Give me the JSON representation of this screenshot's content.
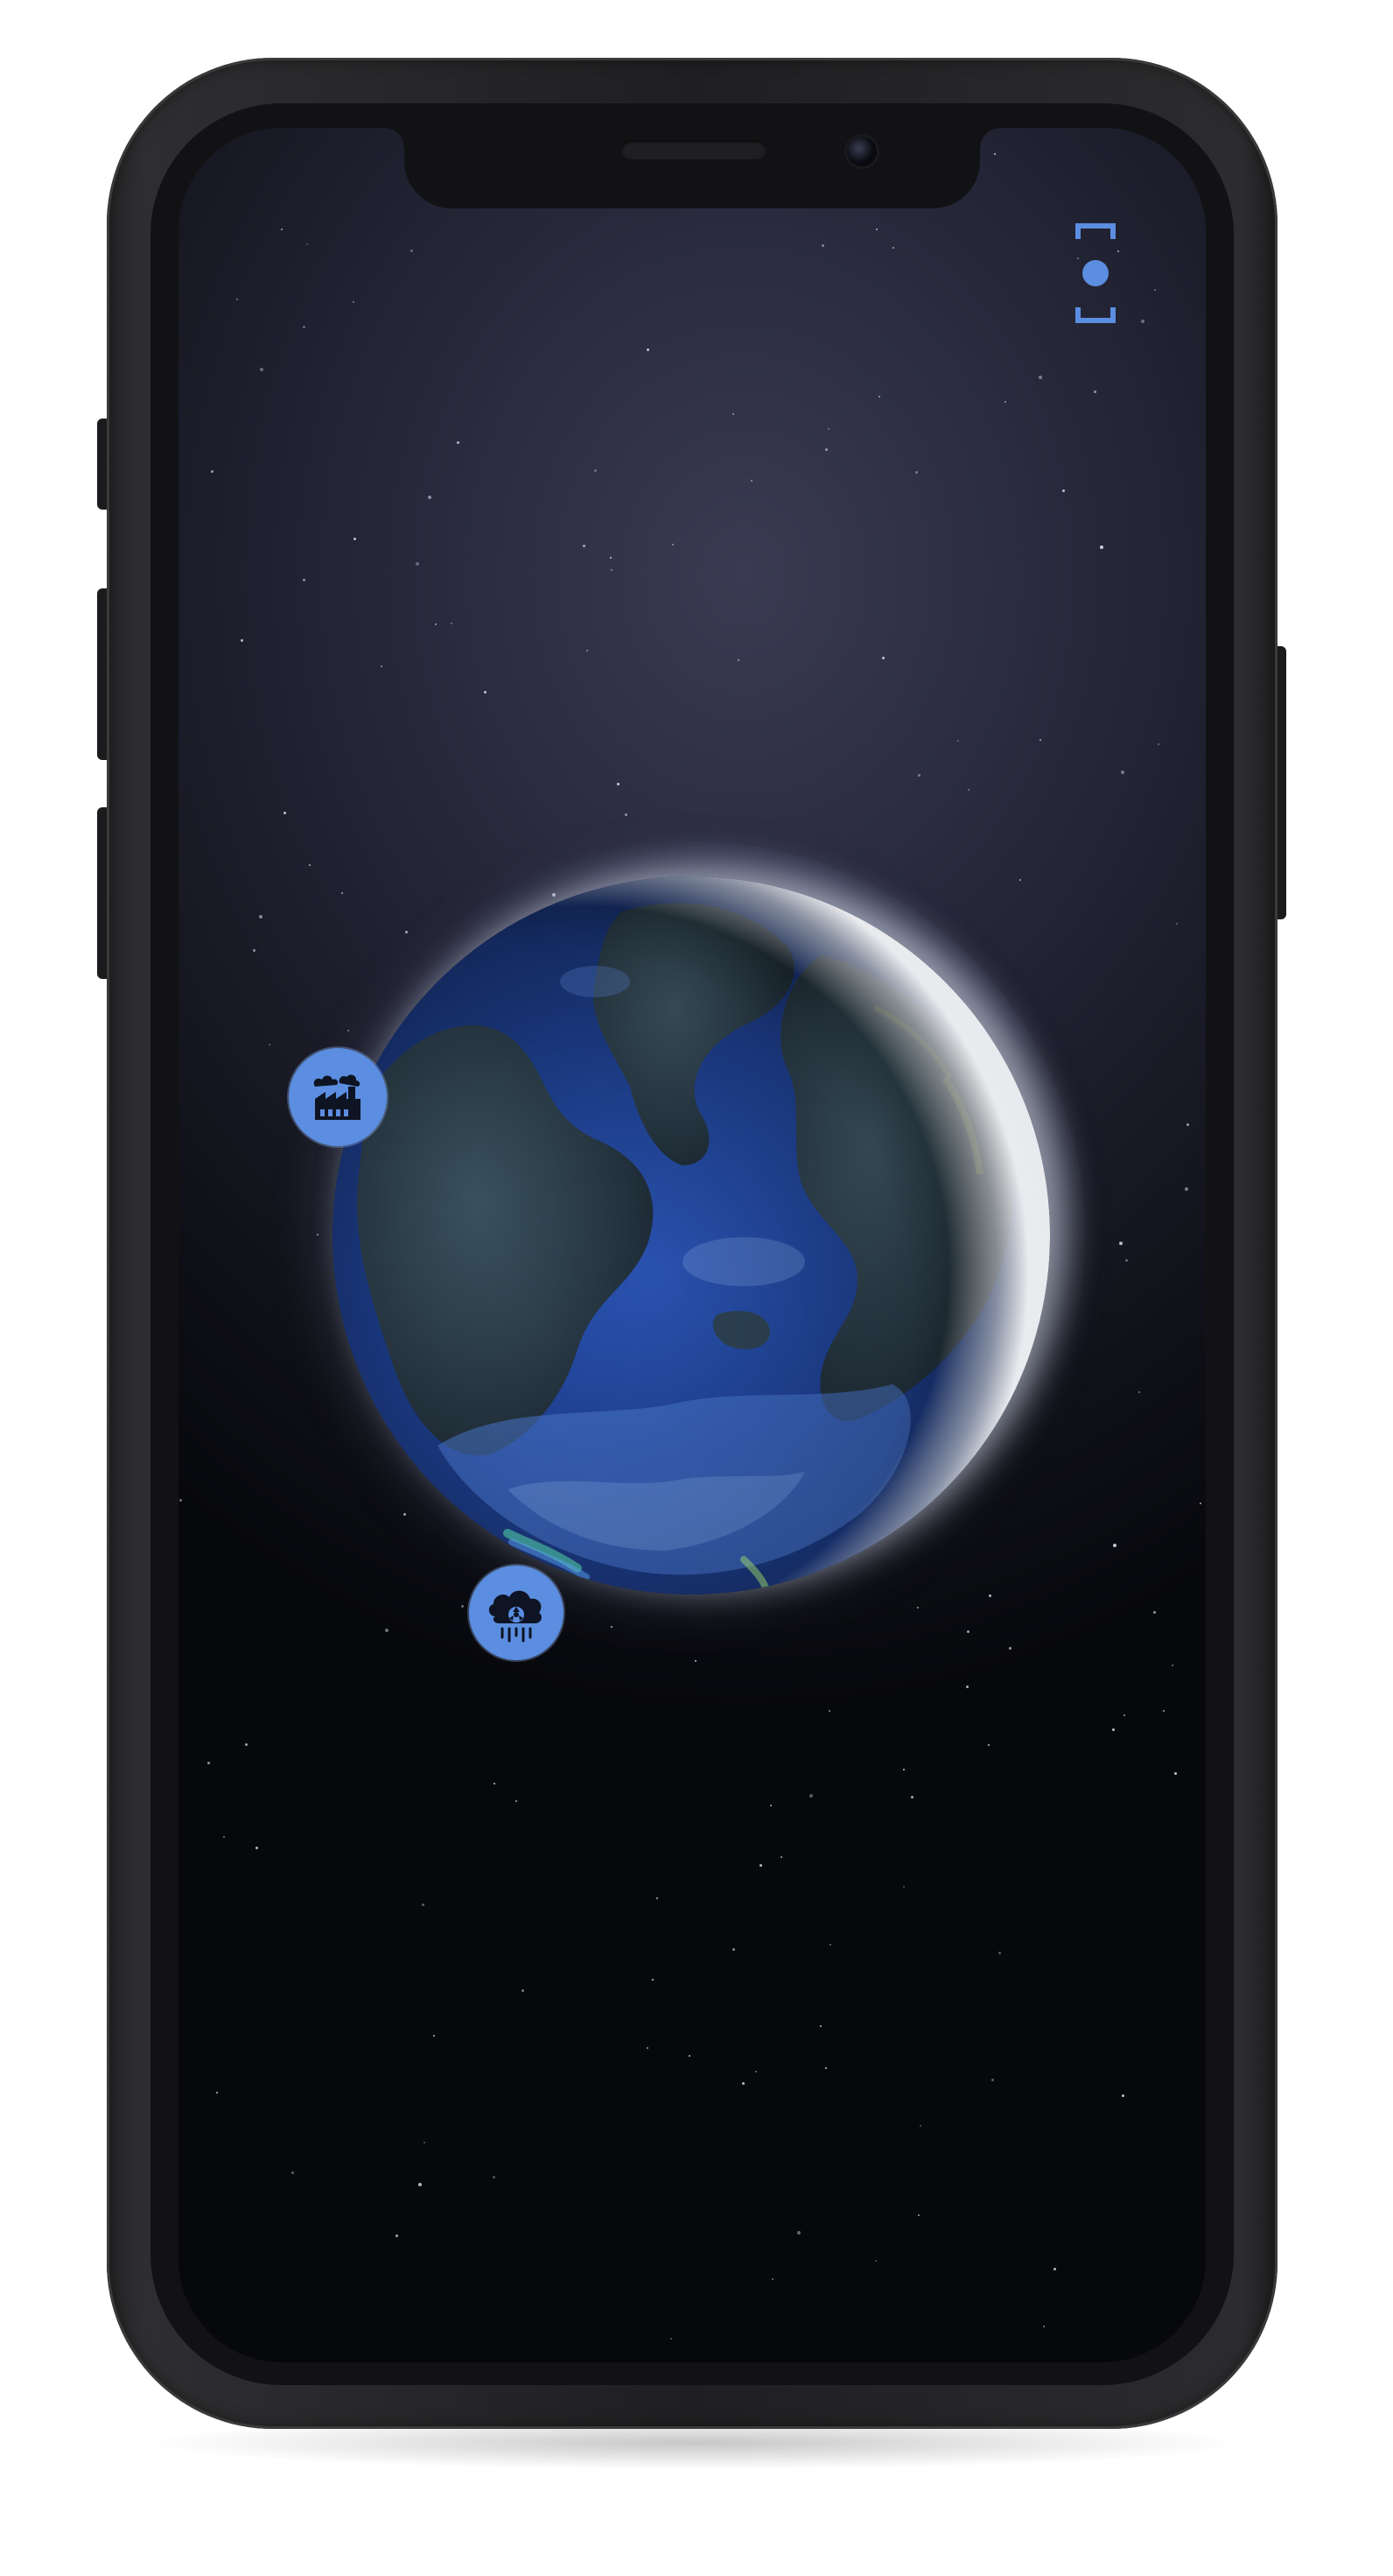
{
  "device": {
    "model": "iphone-x-style"
  },
  "app": {
    "scene": "3d-earth-globe",
    "colors": {
      "background_top": "#3a3b52",
      "background_bottom": "#07080c",
      "accent": "#5b8ee0",
      "ocean": "#2b56b8",
      "land": "#2b3d44",
      "glow": "#e1e6f0"
    },
    "top_right_control": {
      "icon": "scan-focus-icon"
    },
    "hotspots": [
      {
        "id": "pollution",
        "icon": "factory-smoke-icon"
      },
      {
        "id": "toxic",
        "icon": "toxic-cloud-icon"
      }
    ]
  }
}
